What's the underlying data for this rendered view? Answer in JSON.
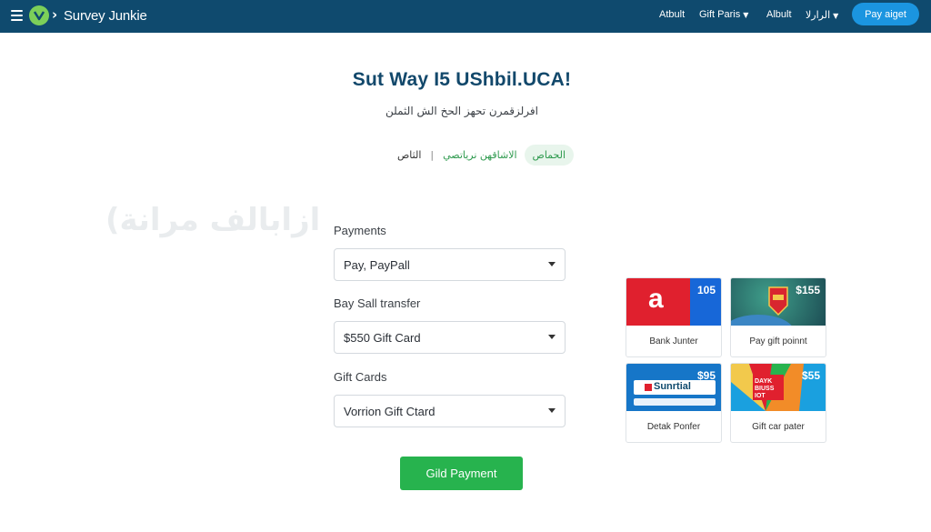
{
  "header": {
    "logo_text": "Survey Junkie",
    "nav": [
      {
        "label": "Atbult"
      },
      {
        "label": "Gift Paris"
      },
      {
        "label": "Albult"
      },
      {
        "label": "الرارلا"
      }
    ],
    "cta_label": "Pay aiget"
  },
  "main": {
    "title": "Sut Way I5 UShbil.UCA!",
    "subtitle": "افرلزقمرن تحهز الحخ الش الثملن",
    "tabs": [
      "الثاص",
      "الاشاقهن نرياتصي",
      "الحماص"
    ],
    "watermark": "(ازابالف مرانة"
  },
  "form": {
    "fields": [
      {
        "label": "Payments",
        "value": "Pay, PayPall"
      },
      {
        "label": "Bay Sall transfer",
        "value": "$550 Gift Card"
      },
      {
        "label": "Gift Cards",
        "value": "Vorrion Gift Ctard"
      }
    ],
    "submit_label": "Gild Payment"
  },
  "gift_cards": [
    {
      "caption": "Bank Junter",
      "price": "105",
      "art_letter": "a",
      "color": "#e0202e"
    },
    {
      "caption": "Pay gift poinnt",
      "price": "$155",
      "color": "#2b6f5a"
    },
    {
      "caption": "Detak Ponfer",
      "price": "$95",
      "art_text": "Sunrtial",
      "color": "#1676c8"
    },
    {
      "caption": "Gift car pater",
      "price": "$55",
      "art_text": "DAYK BIUSS IOT",
      "color": "#1aa0df"
    }
  ],
  "colors": {
    "header_bg": "#0f4a6e",
    "accent_blue": "#1b95e0",
    "accent_green": "#27b34e"
  }
}
